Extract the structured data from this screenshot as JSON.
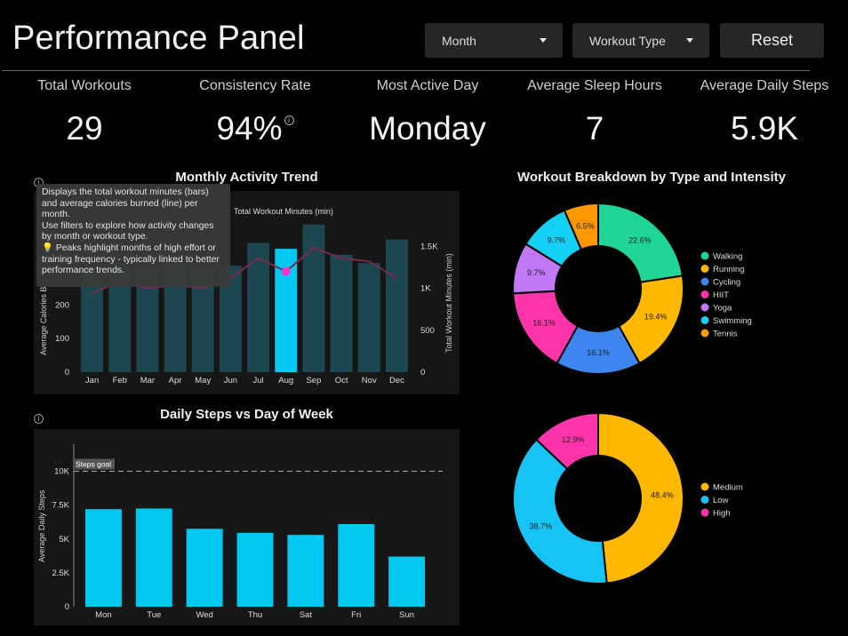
{
  "header": {
    "title": "Performance Panel",
    "month_select": "Month",
    "workout_select": "Workout Type",
    "reset_label": "Reset"
  },
  "kpis": [
    {
      "label": "Total Workouts",
      "value": "29"
    },
    {
      "label": "Consistency Rate",
      "value": "94%"
    },
    {
      "label": "Most Active Day",
      "value": "Monday"
    },
    {
      "label": "Average Sleep Hours",
      "value": "7"
    },
    {
      "label": "Average Daily Steps",
      "value": "5.9K"
    }
  ],
  "tooltip": {
    "line1": "Displays the total workout minutes (bars) and average calories burned (line) per month.",
    "line2": "Use filters to explore how activity changes by month or workout type.",
    "line3": "💡 Peaks highlight months of high effort or training frequency - typically linked to better performance trends."
  },
  "info_icon_glyph": "i",
  "colors": {
    "accent": "#00c8f0",
    "bar_dim": "#1c4650",
    "line": "#7a2a4a",
    "highlight_point": "#ff33cc"
  },
  "chart_data": [
    {
      "type": "bar",
      "title": "Monthly Activity Trend",
      "categories": [
        "Jan",
        "Feb",
        "Mar",
        "Apr",
        "May",
        "Jun",
        "Jul",
        "Aug",
        "Sep",
        "Oct",
        "Nov",
        "Dec"
      ],
      "series": [
        {
          "name": "Total Workout Minutes (min)",
          "axis": "right",
          "values": [
            1250,
            1300,
            1250,
            1280,
            1250,
            1270,
            1540,
            1470,
            1760,
            1400,
            1300,
            1580
          ]
        },
        {
          "type": "line",
          "axis": "left",
          "values": [
            235,
            270,
            250,
            260,
            250,
            280,
            340,
            300,
            370,
            340,
            330,
            280
          ]
        }
      ],
      "highlight": "Aug",
      "ylabel_left": "Average Calories B",
      "ylabel_right": "Total Workout Minutes (min)",
      "ylim_left": [
        0,
        500
      ],
      "ylim_right": [
        0,
        2000
      ],
      "left_ticks": [
        "0",
        "100",
        "200"
      ],
      "right_ticks": [
        "0",
        "500",
        "1K",
        "1.5K"
      ]
    },
    {
      "type": "bar",
      "title": "Daily Steps vs Day of Week",
      "categories": [
        "Mon",
        "Tue",
        "Wed",
        "Thu",
        "Sat",
        "Fri",
        "Sun"
      ],
      "values": [
        7200,
        7250,
        5750,
        5450,
        5300,
        6100,
        3700
      ],
      "ylabel": "Average Daily Steps",
      "ylim": [
        0,
        12000
      ],
      "y_ticks": [
        "0",
        "2.5K",
        "5K",
        "7.5K",
        "10K"
      ],
      "goal": {
        "value": 10000,
        "label": "Steps goal"
      }
    },
    {
      "type": "pie",
      "title": "Workout Breakdown by Type and Intensity",
      "labels": [
        "Walking",
        "Running",
        "Cycling",
        "HIIT",
        "Yoga",
        "Swimming",
        "Tennis"
      ],
      "values": [
        22.6,
        19.4,
        16.1,
        16.1,
        9.7,
        9.7,
        6.5
      ],
      "value_labels": [
        "22.6%",
        "19.4%",
        "16.1%",
        "16.1%",
        "9.7%",
        "9.7%",
        "6.5%"
      ],
      "colors": [
        "#1fd698",
        "#ffb800",
        "#3d86f0",
        "#ff33aa",
        "#c178f5",
        "#15d0f5",
        "#ff9800"
      ]
    },
    {
      "type": "pie",
      "labels": [
        "Medium",
        "Low",
        "High"
      ],
      "values": [
        48.4,
        38.7,
        12.9
      ],
      "value_labels": [
        "48.4%",
        "38.7%",
        "12.9%"
      ],
      "colors": [
        "#ffb800",
        "#15c4f5",
        "#ff33aa"
      ]
    }
  ]
}
